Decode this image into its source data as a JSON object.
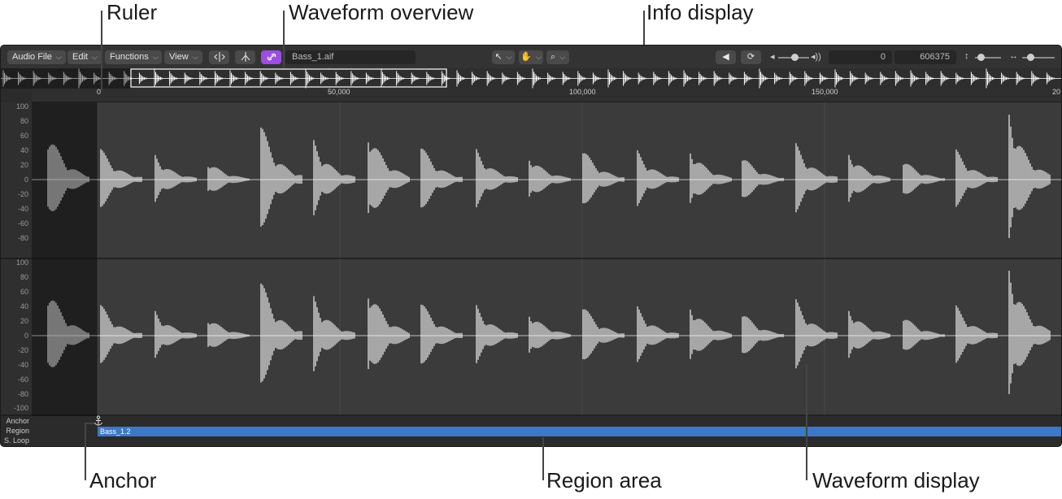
{
  "callouts": {
    "ruler": "Ruler",
    "overview": "Waveform overview",
    "info": "Info display",
    "anchor": "Anchor",
    "region_area": "Region area",
    "waveform_display": "Waveform display"
  },
  "toolbar": {
    "audio_file_menu": "Audio File",
    "edit_menu": "Edit",
    "functions_menu": "Functions",
    "view_menu": "View",
    "file_name": "Bass_1.aif",
    "info_start": "0",
    "info_end": "606375"
  },
  "icons": {
    "chevron": "⌵",
    "pointer": "↖",
    "hand": "✋",
    "zoom": "⌕",
    "speaker": "◀",
    "loop": "⟳",
    "vol_low": "◂",
    "vol_high": "◂))",
    "vertical_zoom": "↕",
    "horizontal_zoom": "↔"
  },
  "ruler": {
    "ticks": [
      "0",
      "50,000",
      "100,000",
      "150,000",
      "20"
    ]
  },
  "amplitude_labels": [
    "100",
    "80",
    "60",
    "40",
    "20",
    "0",
    "-20",
    "-40",
    "-60",
    "-80",
    "-100"
  ],
  "lanes": {
    "anchor": "Anchor",
    "region": "Region",
    "s_loop": "S. Loop"
  },
  "region_name": "Bass_1.2",
  "colors": {
    "accent_purple": "#9b4ee0",
    "region_blue": "#3c78c8",
    "waveform": "#ffffff"
  }
}
